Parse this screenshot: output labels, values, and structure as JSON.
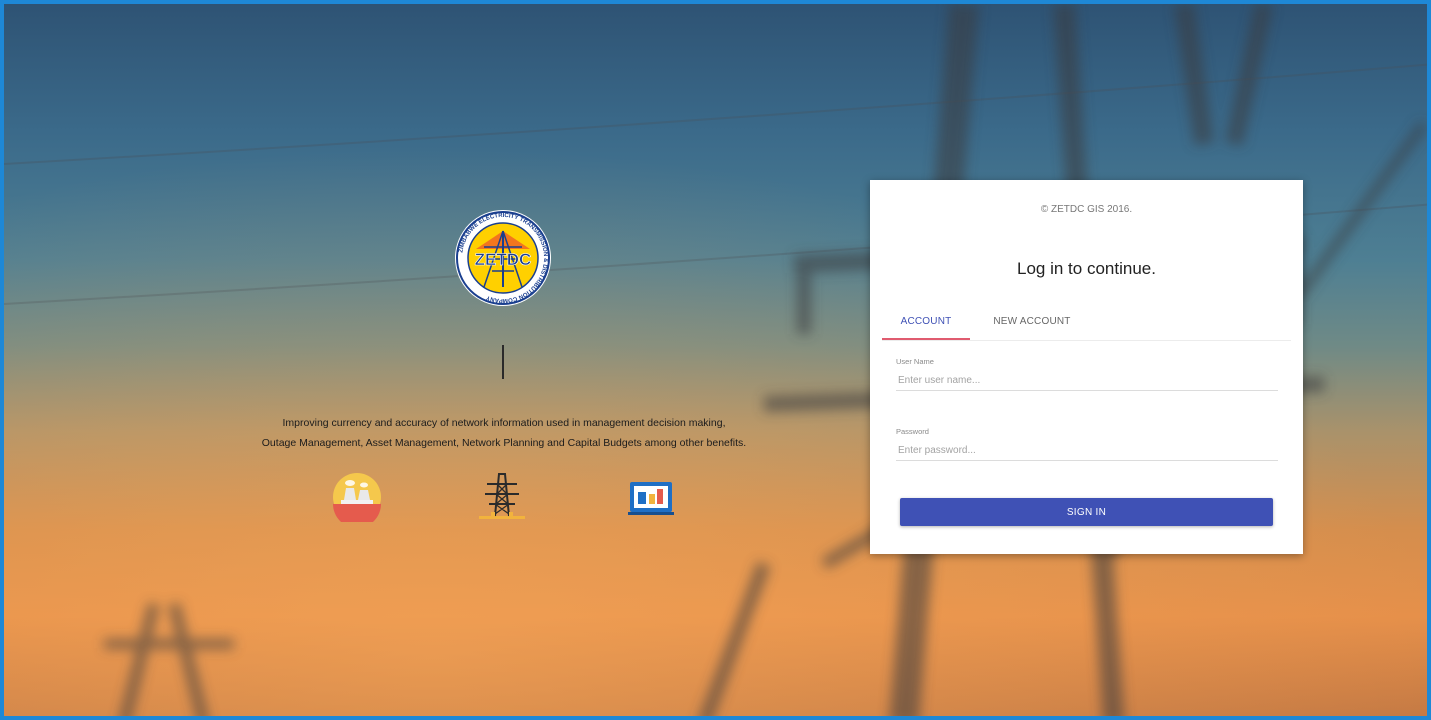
{
  "brand": {
    "logo_text": "ZETDC",
    "logo_ring_text": "ZIMBABWE ELECTRICITY TRANSMISSION & DISTRIBUTION COMPANY",
    "tagline_line1": "Improving currency and accuracy of network information used in management decision making,",
    "tagline_line2": "Outage Management, Asset Management, Network Planning and Capital Budgets among other benefits."
  },
  "feature_icons": [
    "power-plant-icon",
    "transmission-tower-icon",
    "dashboard-chart-icon"
  ],
  "login": {
    "copyright": "© ZETDC GIS 2016.",
    "title": "Log in to continue.",
    "tabs": [
      {
        "label": "ACCOUNT",
        "active": true
      },
      {
        "label": "NEW ACCOUNT",
        "active": false
      }
    ],
    "username": {
      "label": "User Name",
      "placeholder": "Enter user name...",
      "value": ""
    },
    "password": {
      "label": "Password",
      "placeholder": "Enter password...",
      "value": ""
    },
    "submit_label": "SIGN IN"
  },
  "colors": {
    "accent": "#3f51b5",
    "tab_indicator": "#e05b6f",
    "frame_border": "#1e88d6"
  }
}
